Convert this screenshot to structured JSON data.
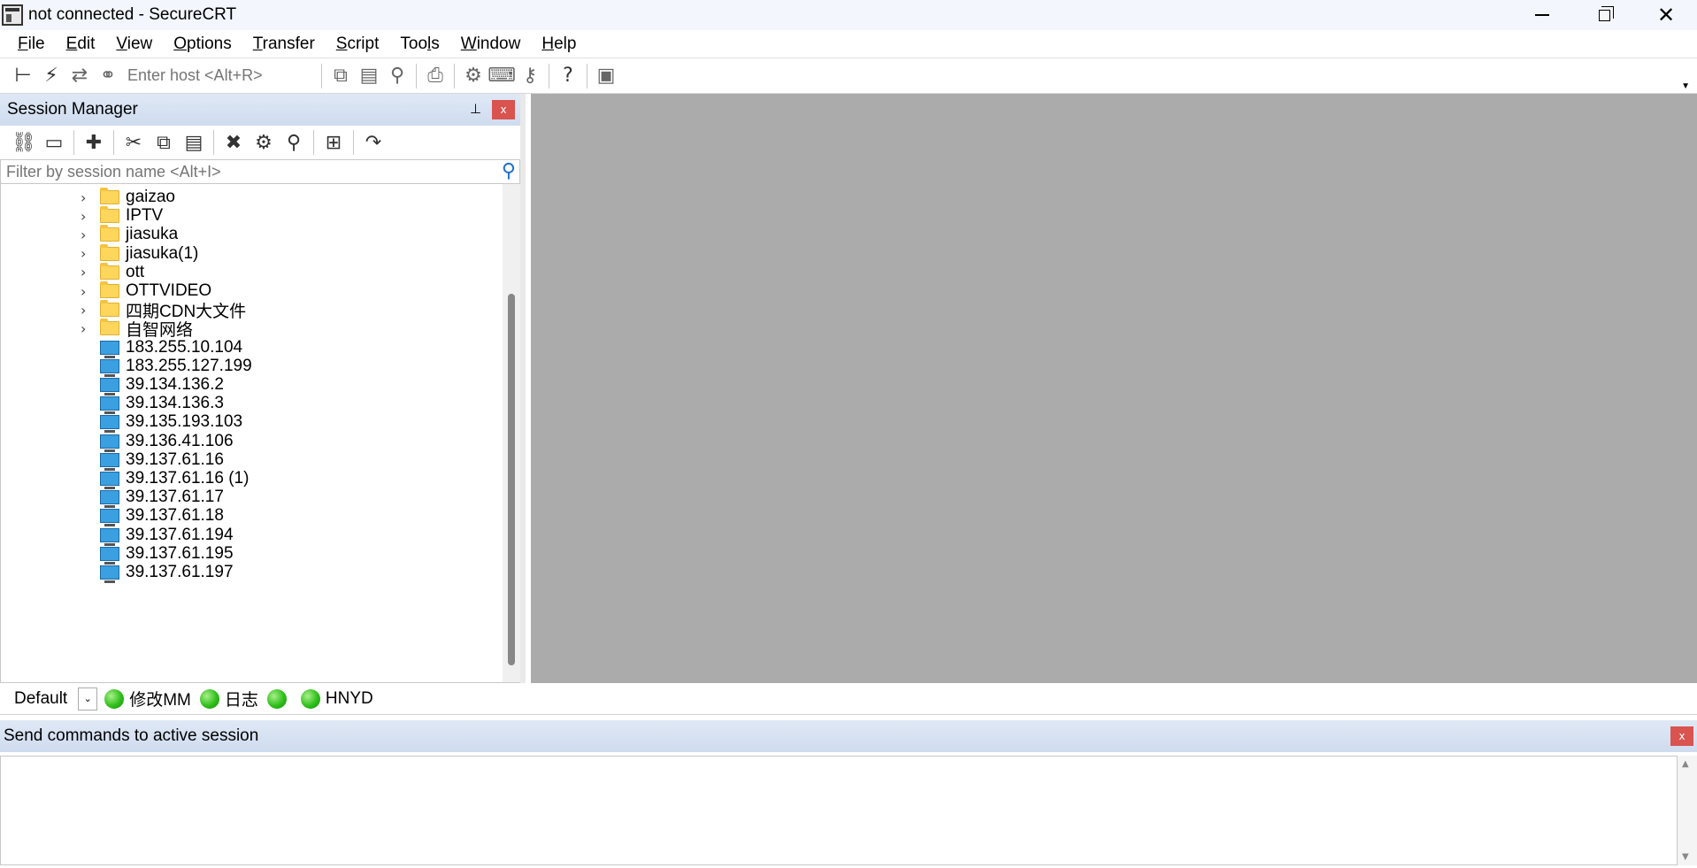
{
  "window": {
    "title": "not connected - SecureCRT",
    "minimize": "minimize",
    "restore": "restore",
    "close": "✕"
  },
  "menu": [
    {
      "label": "File",
      "u": "F",
      "rest": "ile"
    },
    {
      "label": "Edit",
      "u": "E",
      "rest": "dit"
    },
    {
      "label": "View",
      "u": "V",
      "rest": "iew"
    },
    {
      "label": "Options",
      "u": "O",
      "rest": "ptions"
    },
    {
      "label": "Transfer",
      "u": "T",
      "rest": "ransfer"
    },
    {
      "label": "Script",
      "u": "S",
      "rest": "cript"
    },
    {
      "label": "Tools",
      "pre": "Too",
      "u": "l",
      "rest": "s"
    },
    {
      "label": "Window",
      "u": "W",
      "rest": "indow"
    },
    {
      "label": "Help",
      "u": "H",
      "rest": "elp"
    }
  ],
  "toolbar": {
    "host_placeholder": "Enter host <Alt+R>",
    "icons": {
      "connect": "connect-icon",
      "quick_connect": "lightning-icon",
      "reconnect": "reconnect-icon",
      "disconnect": "disconnect-icon",
      "copy": "copy-icon",
      "paste": "paste-icon",
      "find": "binoculars-icon",
      "print": "print-icon",
      "settings": "gear-icon",
      "keymap": "keyboard-icon",
      "keygen": "key-icon",
      "help": "help-icon",
      "screenshot": "image-icon"
    }
  },
  "session_manager": {
    "title": "Session Manager",
    "filter_placeholder": "Filter by session name <Alt+I>",
    "folders": [
      "gaizao",
      "IPTV",
      "jiasuka",
      "jiasuka(1)",
      "ott",
      "OTTVIDEO",
      "四期CDN大文件",
      "自智网络"
    ],
    "sessions": [
      "183.255.10.104",
      "183.255.127.199",
      "39.134.136.2",
      "39.134.136.3",
      "39.135.193.103",
      "39.136.41.106",
      "39.137.61.16",
      "39.137.61.16 (1)",
      "39.137.61.17",
      "39.137.61.18",
      "39.137.61.194",
      "39.137.61.195",
      "39.137.61.197"
    ]
  },
  "button_bar": {
    "selected": "Default",
    "buttons": [
      "修改MM",
      "日志",
      "",
      "HNYD"
    ]
  },
  "command_window": {
    "title": "Send commands to active session",
    "value": ""
  },
  "colors": {
    "workspace": "#ababab",
    "panel_header": "#cfdcef",
    "close_red": "#d9534f",
    "folder": "#ffd65c",
    "session_monitor": "#3aa0e0",
    "button_dot": "#2fbf1a"
  }
}
